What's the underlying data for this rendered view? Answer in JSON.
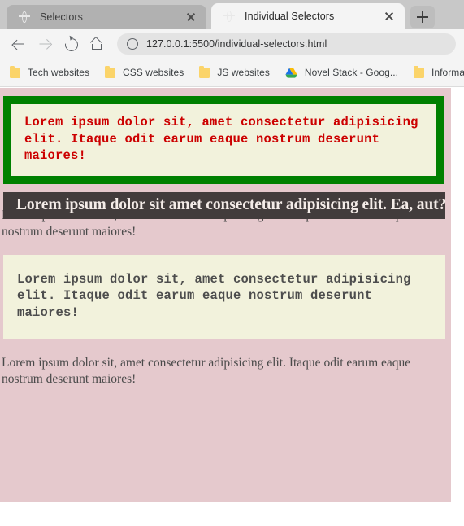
{
  "browser": {
    "tabs": [
      {
        "title": "Selectors",
        "favicon": "globe-icon",
        "active": false
      },
      {
        "title": "Individual Selectors",
        "favicon": "globe-icon",
        "active": true
      }
    ],
    "new_tab_label": "+",
    "nav": {
      "back_label": "Back",
      "forward_label": "Forward",
      "reload_label": "Reload",
      "home_label": "Home",
      "url": "127.0.0.1:5500/individual-selectors.html",
      "site_info_label": "View site information"
    },
    "bookmarks": [
      {
        "label": "Tech websites",
        "icon": "folder-icon"
      },
      {
        "label": "CSS websites",
        "icon": "folder-icon"
      },
      {
        "label": "JS websites",
        "icon": "folder-icon"
      },
      {
        "label": "Novel Stack - Goog...",
        "icon": "google-drive-icon"
      },
      {
        "label": "Informative",
        "icon": "folder-icon"
      }
    ]
  },
  "page": {
    "background_color": "#e5c9cd",
    "blocks": {
      "green_box": {
        "border_color": "#008000",
        "background_color": "#f2f2dc",
        "text_color": "#cc0000",
        "text": "Lorem ipsum dolor sit, amet consectetur adipisicing elit. Itaque odit earum eaque nostrum deserunt maiores!"
      },
      "heading": {
        "background_color": "#423c3c",
        "text_color": "#f4ece8",
        "text": "Lorem ipsum dolor sit amet consectetur adipisicing elit. Ea, aut?"
      },
      "overlapped_paragraph": {
        "text_color": "#4a4a4a",
        "text": "Lorem ipsum dolor sit, amet consectetur adipisicing elit. Itaque odit earum eaque nostrum deserunt maiores!"
      },
      "cream_box": {
        "background_color": "#f2f2dc",
        "text_color": "#4d4d4d",
        "text": "Lorem ipsum dolor sit, amet consectetur adipisicing elit. Itaque odit earum eaque nostrum deserunt maiores!"
      },
      "bottom_paragraph": {
        "text_color": "#4a4a4a",
        "text": "Lorem ipsum dolor sit, amet consectetur adipisicing elit. Itaque odit earum eaque nostrum deserunt maiores!"
      }
    }
  }
}
